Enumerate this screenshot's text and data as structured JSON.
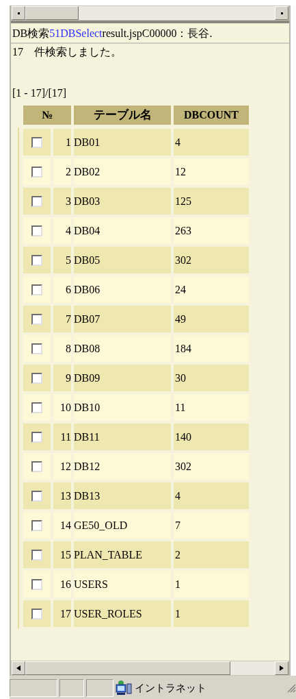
{
  "page_title": {
    "prefix": "DB検索",
    "link": "51DBSelect",
    "suffix": "result.jspC00000：長谷."
  },
  "message": "17　件検索しました。",
  "range": "[1 - 17]/[17]",
  "table": {
    "columns": [
      "№",
      "テーブル名",
      "DBCOUNT"
    ],
    "rows": [
      {
        "checked": false,
        "no": "1",
        "name": "DB01",
        "count": "4"
      },
      {
        "checked": false,
        "no": "2",
        "name": "DB02",
        "count": "12"
      },
      {
        "checked": false,
        "no": "3",
        "name": "DB03",
        "count": "125"
      },
      {
        "checked": false,
        "no": "4",
        "name": "DB04",
        "count": "263"
      },
      {
        "checked": false,
        "no": "5",
        "name": "DB05",
        "count": "302"
      },
      {
        "checked": false,
        "no": "6",
        "name": "DB06",
        "count": "24"
      },
      {
        "checked": false,
        "no": "7",
        "name": "DB07",
        "count": "49"
      },
      {
        "checked": false,
        "no": "8",
        "name": "DB08",
        "count": "184"
      },
      {
        "checked": false,
        "no": "9",
        "name": "DB09",
        "count": "30"
      },
      {
        "checked": false,
        "no": "10",
        "name": "DB10",
        "count": "11"
      },
      {
        "checked": false,
        "no": "11",
        "name": "DB11",
        "count": "140"
      },
      {
        "checked": false,
        "no": "12",
        "name": "DB12",
        "count": "302"
      },
      {
        "checked": false,
        "no": "13",
        "name": "DB13",
        "count": "4"
      },
      {
        "checked": false,
        "no": "14",
        "name": "GE50_OLD",
        "count": "7"
      },
      {
        "checked": false,
        "no": "15",
        "name": "PLAN_TABLE",
        "count": "2"
      },
      {
        "checked": false,
        "no": "16",
        "name": "USERS",
        "count": "1"
      },
      {
        "checked": false,
        "no": "17",
        "name": "USER_ROLES",
        "count": "1"
      }
    ]
  },
  "status_bar": {
    "zone": "イントラネット"
  }
}
